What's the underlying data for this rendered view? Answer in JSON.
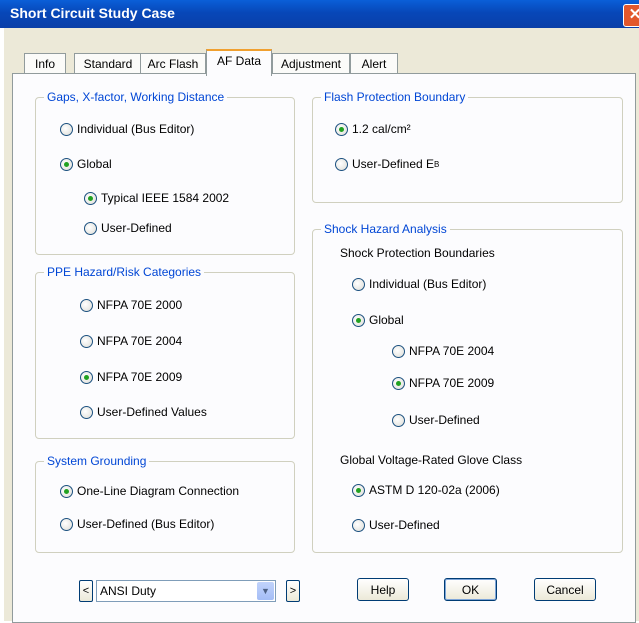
{
  "window": {
    "title": "Short Circuit Study Case",
    "close_glyph": "✕"
  },
  "tabs": [
    "Info",
    "Standard",
    "Arc Flash",
    "AF Data",
    "Adjustment",
    "Alert"
  ],
  "active_tab": "AF Data",
  "gaps": {
    "legend": "Gaps, X-factor, Working Distance",
    "individual": "Individual (Bus Editor)",
    "global": "Global",
    "typical": "Typical IEEE 1584 2002",
    "user_defined": "User-Defined"
  },
  "ppe": {
    "legend": "PPE Hazard/Risk Categories",
    "nfpa2000": "NFPA 70E 2000",
    "nfpa2004": "NFPA 70E 2004",
    "nfpa2009": "NFPA 70E 2009",
    "user_defined_values": "User-Defined Values"
  },
  "grounding": {
    "legend": "System Grounding",
    "one_line": "One-Line Diagram Connection",
    "user_defined_bus": "User-Defined (Bus Editor)"
  },
  "flash": {
    "legend": "Flash Protection Boundary",
    "option1": "1.2 cal/cm²",
    "user_defined_prefix": "User-Defined E",
    "user_defined_sub": "B"
  },
  "shock": {
    "legend": "Shock Hazard Analysis",
    "boundaries_label": "Shock Protection Boundaries",
    "individual": "Individual (Bus Editor)",
    "global": "Global",
    "nfpa2004": "NFPA 70E 2004",
    "nfpa2009": "NFPA 70E 2009",
    "user_defined": "User-Defined",
    "glove_label": "Global Voltage-Rated Glove Class",
    "astm": "ASTM D 120-02a (2006)",
    "glove_user_defined": "User-Defined"
  },
  "footer": {
    "prev_glyph": "<",
    "next_glyph": ">",
    "combo_value": "ANSI Duty",
    "combo_arrow": "▼",
    "help": "Help",
    "ok": "OK",
    "cancel": "Cancel"
  },
  "colors": {
    "title_bar": "#0a4fc8",
    "legend_text": "#0046d5",
    "radio_selected": "#21a121"
  }
}
